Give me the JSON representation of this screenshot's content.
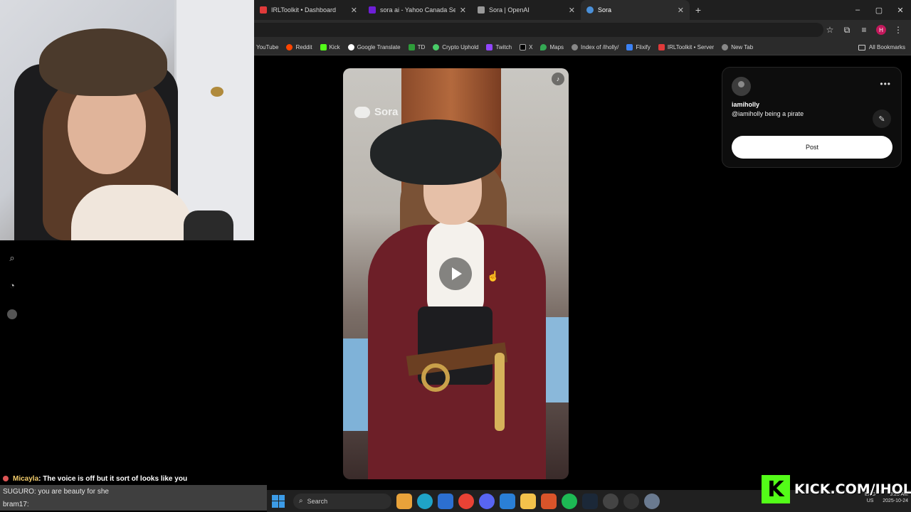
{
  "browser": {
    "tabs": [
      {
        "title": "IRLToolkit • Dashboard",
        "fav": "#e03a3a",
        "active": false
      },
      {
        "title": "sora ai - Yahoo Canada Search",
        "fav": "#6e1fd6",
        "active": false
      },
      {
        "title": "Sora | OpenAI",
        "fav": "#999999",
        "active": false
      },
      {
        "title": "Sora",
        "fav": "#4a90d9",
        "active": true
      }
    ],
    "new_tab": "+",
    "window_controls": [
      "–",
      "▢",
      "✕"
    ],
    "bookmarks": [
      {
        "label": "YouTube",
        "color": "#ff3333"
      },
      {
        "label": "Reddit",
        "color": "#ff4500"
      },
      {
        "label": "Kick",
        "color": "#53fc18"
      },
      {
        "label": "Google Translate",
        "color": "#4285f4"
      },
      {
        "label": "TD",
        "color": "#2e9d3a"
      },
      {
        "label": "Crypto Uphold",
        "color": "#49cc68"
      },
      {
        "label": "Twitch",
        "color": "#9146ff"
      },
      {
        "label": "X",
        "color": "#000000"
      },
      {
        "label": "Maps",
        "color": "#34a853"
      },
      {
        "label": "Index of /iholly/",
        "color": "#888888"
      },
      {
        "label": "Flixify",
        "color": "#3b82f6"
      },
      {
        "label": "IRLToolkit • Server",
        "color": "#e03a3a"
      },
      {
        "label": "New Tab",
        "color": "#888888"
      }
    ],
    "all_bookmarks": "All Bookmarks",
    "profile_initial": "H"
  },
  "video": {
    "watermark": "Sora",
    "mute_icon": "speaker-icon"
  },
  "post_panel": {
    "username": "iamiholly",
    "prompt": "@iamiholly being a pirate",
    "more_label": "•••",
    "post_button": "Post"
  },
  "chat": [
    {
      "user": "Micayla",
      "message": " : The voice is off but it sort of looks like you"
    },
    {
      "user": "SUGURO",
      "message": " : you are beauty for she"
    },
    {
      "user": "bram17",
      "message": " : "
    }
  ],
  "taskbar": {
    "search_placeholder": "Search",
    "lang_top": "ENG",
    "lang_bottom": "US",
    "time": "3:25 AM",
    "date": "2025-10-24"
  },
  "kick": {
    "logo_letter": "K",
    "url": "KICK.COM/IHOLLY"
  }
}
